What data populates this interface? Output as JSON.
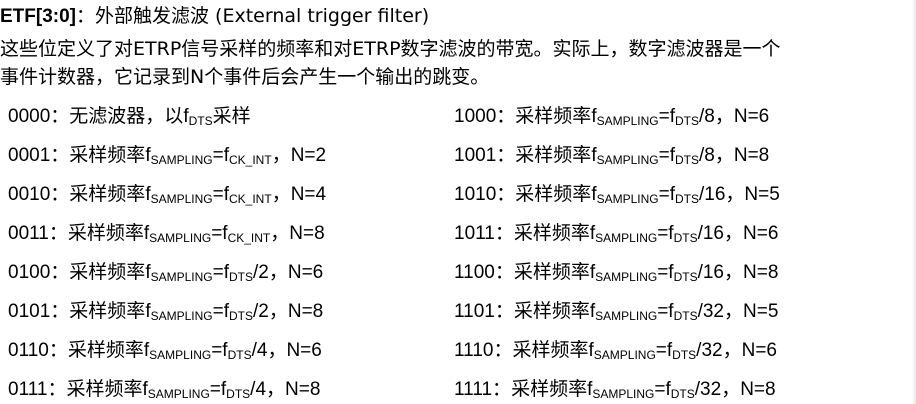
{
  "heading": {
    "field": "ETF[3:0]",
    "colon": "：",
    "title": "外部触发滤波 (External trigger filter)"
  },
  "description": {
    "line1": "这些位定义了对ETRP信号采样的频率和对ETRP数字滤波的带宽。实际上，数字滤波器是一个",
    "line2": "事件计数器，它记录到N个事件后会产生一个输出的跳变。"
  },
  "rows_left": [
    {
      "code": "0000",
      "sep": "：",
      "text": "无滤波器，以",
      "f": "f",
      "sub": "DTS",
      "tail": "采样",
      "eq": "",
      "f2": "",
      "sub2": "",
      "div": "",
      "n": ""
    },
    {
      "code": "0001",
      "sep": "：",
      "text": "采样频率",
      "f": "f",
      "sub": "SAMPLING",
      "tail": "",
      "eq": "=",
      "f2": "f",
      "sub2": "CK_INT",
      "div": "",
      "n": "，N=2"
    },
    {
      "code": "0010",
      "sep": "：",
      "text": "采样频率",
      "f": "f",
      "sub": "SAMPLING",
      "tail": "",
      "eq": "=",
      "f2": "f",
      "sub2": "CK_INT",
      "div": "",
      "n": "，N=4"
    },
    {
      "code": "0011",
      "sep": "：",
      "text": "采样频率",
      "f": "f",
      "sub": "SAMPLING",
      "tail": "",
      "eq": "=",
      "f2": "f",
      "sub2": "CK_INT",
      "div": "",
      "n": "，N=8"
    },
    {
      "code": "0100",
      "sep": "：",
      "text": "采样频率",
      "f": "f",
      "sub": "SAMPLING",
      "tail": "",
      "eq": "=",
      "f2": "f",
      "sub2": "DTS",
      "div": "/2",
      "n": "，N=6"
    },
    {
      "code": "0101",
      "sep": "：",
      "text": "采样频率",
      "f": "f",
      "sub": "SAMPLING",
      "tail": "",
      "eq": "=",
      "f2": "f",
      "sub2": "DTS",
      "div": "/2",
      "n": "，N=8"
    },
    {
      "code": "0110",
      "sep": "：",
      "text": "采样频率",
      "f": "f",
      "sub": "SAMPLING",
      "tail": "",
      "eq": "=",
      "f2": "f",
      "sub2": "DTS",
      "div": "/4",
      "n": "，N=6"
    },
    {
      "code": "0111",
      "sep": "：",
      "text": "采样频率",
      "f": "f",
      "sub": "SAMPLING",
      "tail": "",
      "eq": "=",
      "f2": "f",
      "sub2": "DTS",
      "div": "/4",
      "n": "，N=8"
    }
  ],
  "rows_right": [
    {
      "code": "1000",
      "sep": "：",
      "text": "采样频率",
      "f": "f",
      "sub": "SAMPLING",
      "eq": "=",
      "f2": "f",
      "sub2": "DTS",
      "div": "/8",
      "n": "，N=6"
    },
    {
      "code": "1001",
      "sep": "：",
      "text": "采样频率",
      "f": "f",
      "sub": "SAMPLING",
      "eq": "=",
      "f2": "f",
      "sub2": "DTS",
      "div": "/8",
      "n": "，N=8"
    },
    {
      "code": "1010",
      "sep": "：",
      "text": "采样频率",
      "f": "f",
      "sub": "SAMPLING",
      "eq": "=",
      "f2": "f",
      "sub2": "DTS",
      "div": "/16",
      "n": "，N=5"
    },
    {
      "code": "1011",
      "sep": "：",
      "text": "采样频率",
      "f": "f",
      "sub": "SAMPLING",
      "eq": "=",
      "f2": "f",
      "sub2": "DTS",
      "div": "/16",
      "n": "，N=6"
    },
    {
      "code": "1100",
      "sep": "：",
      "text": "采样频率",
      "f": "f",
      "sub": "SAMPLING",
      "eq": "=",
      "f2": "f",
      "sub2": "DTS",
      "div": "/16",
      "n": "，N=8"
    },
    {
      "code": "1101",
      "sep": "：",
      "text": "采样频率",
      "f": "f",
      "sub": "SAMPLING",
      "eq": "=",
      "f2": "f",
      "sub2": "DTS",
      "div": "/32",
      "n": "，N=5"
    },
    {
      "code": "1110",
      "sep": "：",
      "text": "采样频率",
      "f": "f",
      "sub": "SAMPLING",
      "eq": "=",
      "f2": "f",
      "sub2": "DTS",
      "div": "/32",
      "n": "，N=6"
    },
    {
      "code": "1111",
      "sep": "：",
      "text": "采样频率",
      "f": "f",
      "sub": "SAMPLING",
      "eq": "=",
      "f2": "f",
      "sub2": "DTS",
      "div": "/32",
      "n": "，N=8"
    }
  ]
}
